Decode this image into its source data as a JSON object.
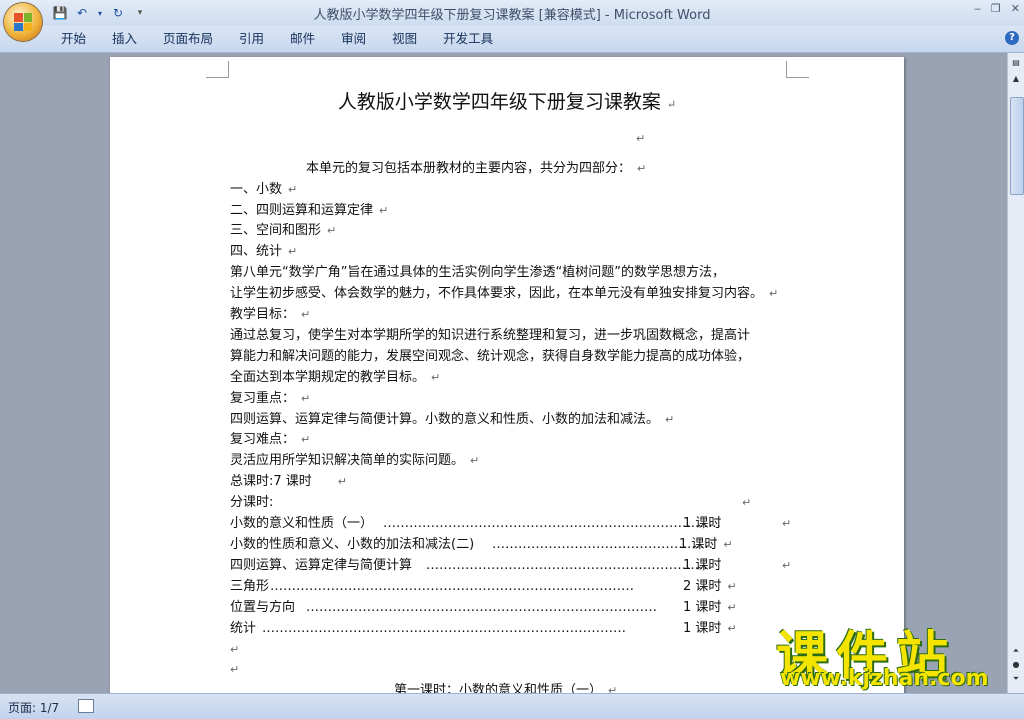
{
  "window": {
    "title": "人教版小学数学四年级下册复习课教案 [兼容模式] - Microsoft Word",
    "controls": [
      "‒",
      "❐",
      "✕"
    ]
  },
  "quick_access": [
    "save-icon",
    "undo-icon",
    "redo-icon",
    "customize-icon"
  ],
  "ribbon": {
    "tabs": [
      "开始",
      "插入",
      "页面布局",
      "引用",
      "邮件",
      "审阅",
      "视图",
      "开发工具"
    ],
    "help_label": "?"
  },
  "document": {
    "title": "人教版小学数学四年级下册复习课教案",
    "intro": "本单元的复习包括本册教材的主要内容，共分为四部分：",
    "parts": [
      "一、小数",
      "二、四则运算和运算定律",
      "三、空间和图形",
      "四、统计"
    ],
    "para1": [
      "第八单元“数学广角”旨在通过具体的生活实例向学生渗透“植树问题”的数学思想方法，",
      "让学生初步感受、体会数学的魅力，不作具体要求，因此，在本单元没有单独安排复习内容。"
    ],
    "goal_heading": "教学目标：",
    "goal_text": [
      "通过总复习，使学生对本学期所学的知识进行系统整理和复习，进一步巩固数概念，提高计",
      "算能力和解决问题的能力，发展空间观念、统计观念，获得自身数学能力提高的成功体验，",
      "全面达到本学期规定的教学目标。"
    ],
    "key_heading": "复习重点：",
    "key_text": "四则运算、运算定律与简便计算。小数的意义和性质、小数的加法和减法。",
    "hard_heading": "复习难点：",
    "hard_text": "灵活应用所学知识解决简单的实际问题。",
    "total_hours": "总课时:7 课时",
    "split_heading": "分课时:",
    "schedule": [
      {
        "name": "小数的意义和性质（一）",
        "hours": "1 课时"
      },
      {
        "name": "小数的性质和意义、小数的加法和减法(二)",
        "hours": "1 课时"
      },
      {
        "name": "四则运算、运算定律与简便计算",
        "hours": "1 课时"
      },
      {
        "name": "三角形",
        "hours": "2 课时"
      },
      {
        "name": "位置与方向",
        "hours": "1 课时"
      },
      {
        "name": "统计",
        "hours": "1 课时"
      }
    ],
    "next_heading": "第一课时：小数的意义和性质（一）",
    "para_mark": "↵"
  },
  "status": {
    "page": "页面: 1/7"
  },
  "watermark": {
    "cn": "课件站",
    "url": "www.kjzhan.com"
  }
}
